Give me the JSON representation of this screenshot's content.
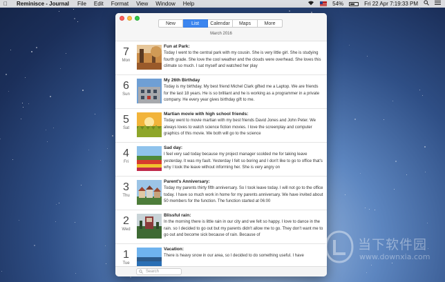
{
  "menubar": {
    "app_name": "Reminisce - Journal",
    "items": [
      "File",
      "Edit",
      "Format",
      "View",
      "Window",
      "Help"
    ],
    "battery_percent": "54%",
    "clock": "Fri 22 Apr  7:19:33 PM"
  },
  "toolbar": {
    "tabs": [
      {
        "label": "New"
      },
      {
        "label": "List"
      },
      {
        "label": "Calendar"
      },
      {
        "label": "Maps"
      },
      {
        "label": "More"
      }
    ],
    "active_tab": "List"
  },
  "month_header": "March 2016",
  "entries": [
    {
      "day": "7",
      "weekday": "Mon",
      "title": "Fun at Park:",
      "text": "Today I went to the central park with my cousin. She is very little girl. She is studying fourth grade. She love the cool weather and the clouds were overhead. She loves this climate so much. I sat myself and watched her play",
      "image": "park-photo"
    },
    {
      "day": "6",
      "weekday": "Sun",
      "title": "My 26th Birthday",
      "text": "Today is my birthday. My best friend Michel Clark gifted me a Laptop. We are friends for the last 18 years. He is so brilliant and he is working as a programmer in a private company. He every year gives birthday gift to me.",
      "image": "building-photo"
    },
    {
      "day": "5",
      "weekday": "Sat",
      "title": "Martian movie with high school friends:",
      "text": "Today went to movie martian with my best friends David Jones and John Peter. We always loves to watch science fiction movies. I love the screenplay and computer graphics of this movie. We both will go to the science",
      "image": "sunset-field-photo"
    },
    {
      "day": "4",
      "weekday": "Fri",
      "title": "Sad day:",
      "text": "I feel very sad today because my project manager scolded me for taking leave yesterday. It was my fault. Yesterday I felt so boring and I don't like to go to office that's why I took the leave without informing her. She is very angry on",
      "image": "flower-field-photo"
    },
    {
      "day": "3",
      "weekday": "Thu",
      "title": "Parent's Anniversary:",
      "text": "Today my parents thirty fifth anniversary. So I took leave today. I will not go to the office today. I have so much work in home for my parents anniversary. We have invited about 50 members for the function. The function started at 06:00",
      "image": "houses-photo"
    },
    {
      "day": "2",
      "weekday": "Wed",
      "title": "Blissful rain:",
      "text": "In the morning there is little rain in our city and we felt so happy. I love to dance in the rain. so I decided to go out but my parents didn't allow me to go. They don't want me to go out and become sick because of rain. Because of",
      "image": "rain-photo"
    },
    {
      "day": "1",
      "weekday": "Tue",
      "title": "Vacation:",
      "text": "There is heavy snow in our area, so I decided to do something useful. I have",
      "image": "lake-photo"
    }
  ],
  "search": {
    "placeholder": "Search"
  },
  "watermark": {
    "title": "当下软件园",
    "url": "www.downxia.com"
  }
}
